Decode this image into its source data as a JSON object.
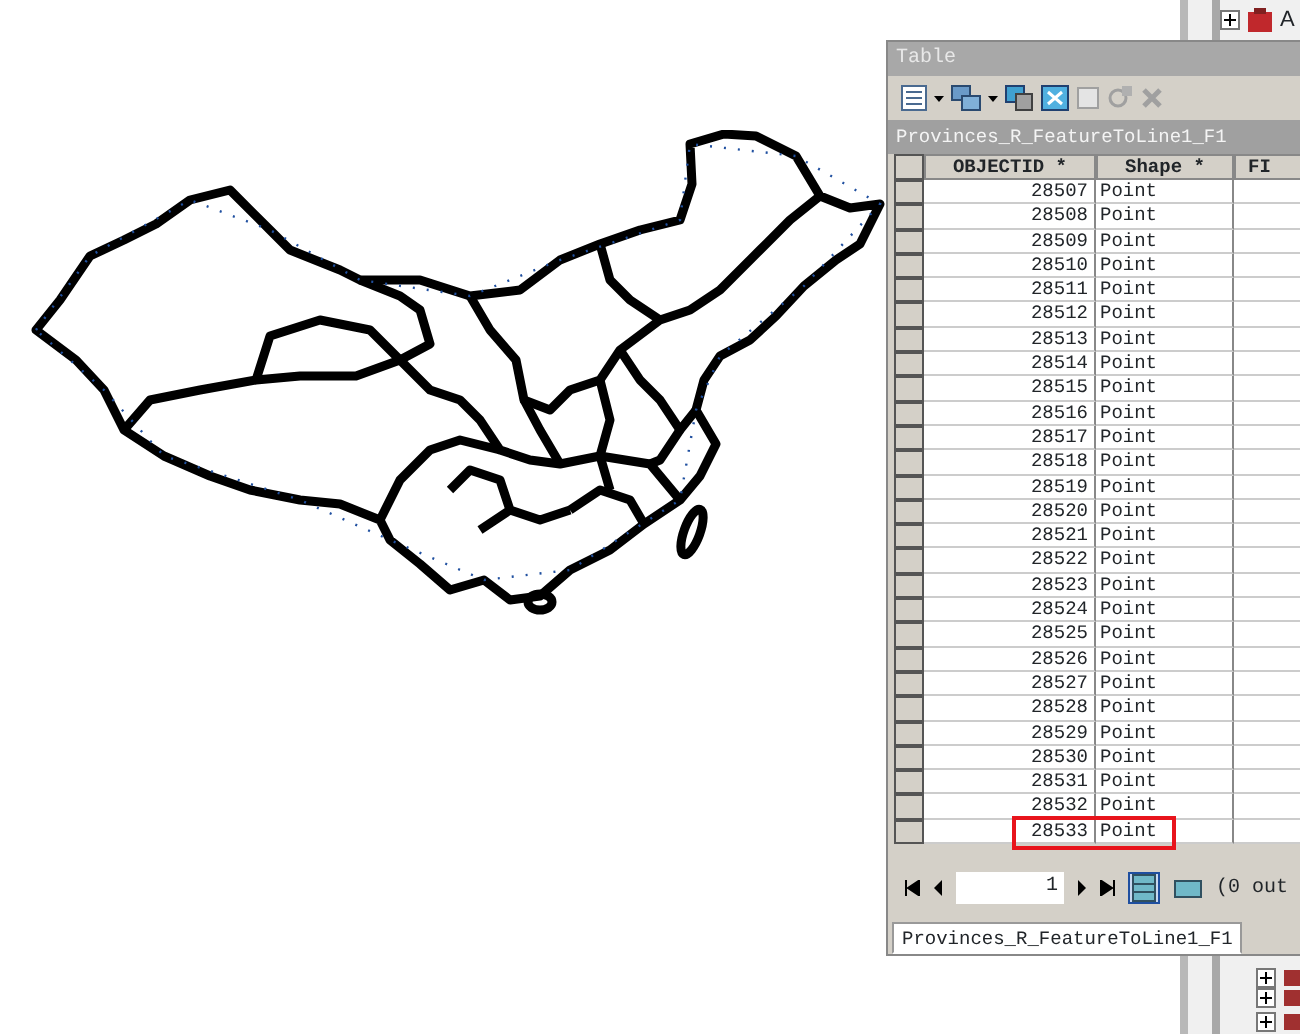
{
  "window": {
    "title": "Table"
  },
  "layer_bar": "Provinces_R_FeatureToLine1_F1",
  "columns": [
    "OBJECTID *",
    "Shape *",
    "FI"
  ],
  "rows": [
    {
      "objectid": "28507",
      "shape": "Point",
      "highlighted": false
    },
    {
      "objectid": "28508",
      "shape": "Point",
      "highlighted": false
    },
    {
      "objectid": "28509",
      "shape": "Point",
      "highlighted": false
    },
    {
      "objectid": "28510",
      "shape": "Point",
      "highlighted": false
    },
    {
      "objectid": "28511",
      "shape": "Point",
      "highlighted": false
    },
    {
      "objectid": "28512",
      "shape": "Point",
      "highlighted": false
    },
    {
      "objectid": "28513",
      "shape": "Point",
      "highlighted": false
    },
    {
      "objectid": "28514",
      "shape": "Point",
      "highlighted": false
    },
    {
      "objectid": "28515",
      "shape": "Point",
      "highlighted": false
    },
    {
      "objectid": "28516",
      "shape": "Point",
      "highlighted": false
    },
    {
      "objectid": "28517",
      "shape": "Point",
      "highlighted": false
    },
    {
      "objectid": "28518",
      "shape": "Point",
      "highlighted": false
    },
    {
      "objectid": "28519",
      "shape": "Point",
      "highlighted": false
    },
    {
      "objectid": "28520",
      "shape": "Point",
      "highlighted": false
    },
    {
      "objectid": "28521",
      "shape": "Point",
      "highlighted": false
    },
    {
      "objectid": "28522",
      "shape": "Point",
      "highlighted": false
    },
    {
      "objectid": "28523",
      "shape": "Point",
      "highlighted": false
    },
    {
      "objectid": "28524",
      "shape": "Point",
      "highlighted": false
    },
    {
      "objectid": "28525",
      "shape": "Point",
      "highlighted": false
    },
    {
      "objectid": "28526",
      "shape": "Point",
      "highlighted": false
    },
    {
      "objectid": "28527",
      "shape": "Point",
      "highlighted": false
    },
    {
      "objectid": "28528",
      "shape": "Point",
      "highlighted": false
    },
    {
      "objectid": "28529",
      "shape": "Point",
      "highlighted": false
    },
    {
      "objectid": "28530",
      "shape": "Point",
      "highlighted": false
    },
    {
      "objectid": "28531",
      "shape": "Point",
      "highlighted": false
    },
    {
      "objectid": "28532",
      "shape": "Point",
      "highlighted": false
    },
    {
      "objectid": "28533",
      "shape": "Point",
      "highlighted": true
    }
  ],
  "pager": {
    "page": "1",
    "status": "(0 out"
  },
  "view_buttons": [
    {
      "selected": true
    },
    {
      "selected": false
    }
  ],
  "tabs": [
    {
      "label": "Provinces_R_FeatureToLine1_F1",
      "selected": true
    }
  ],
  "tree": {
    "items": [
      {
        "label": "A"
      }
    ]
  }
}
